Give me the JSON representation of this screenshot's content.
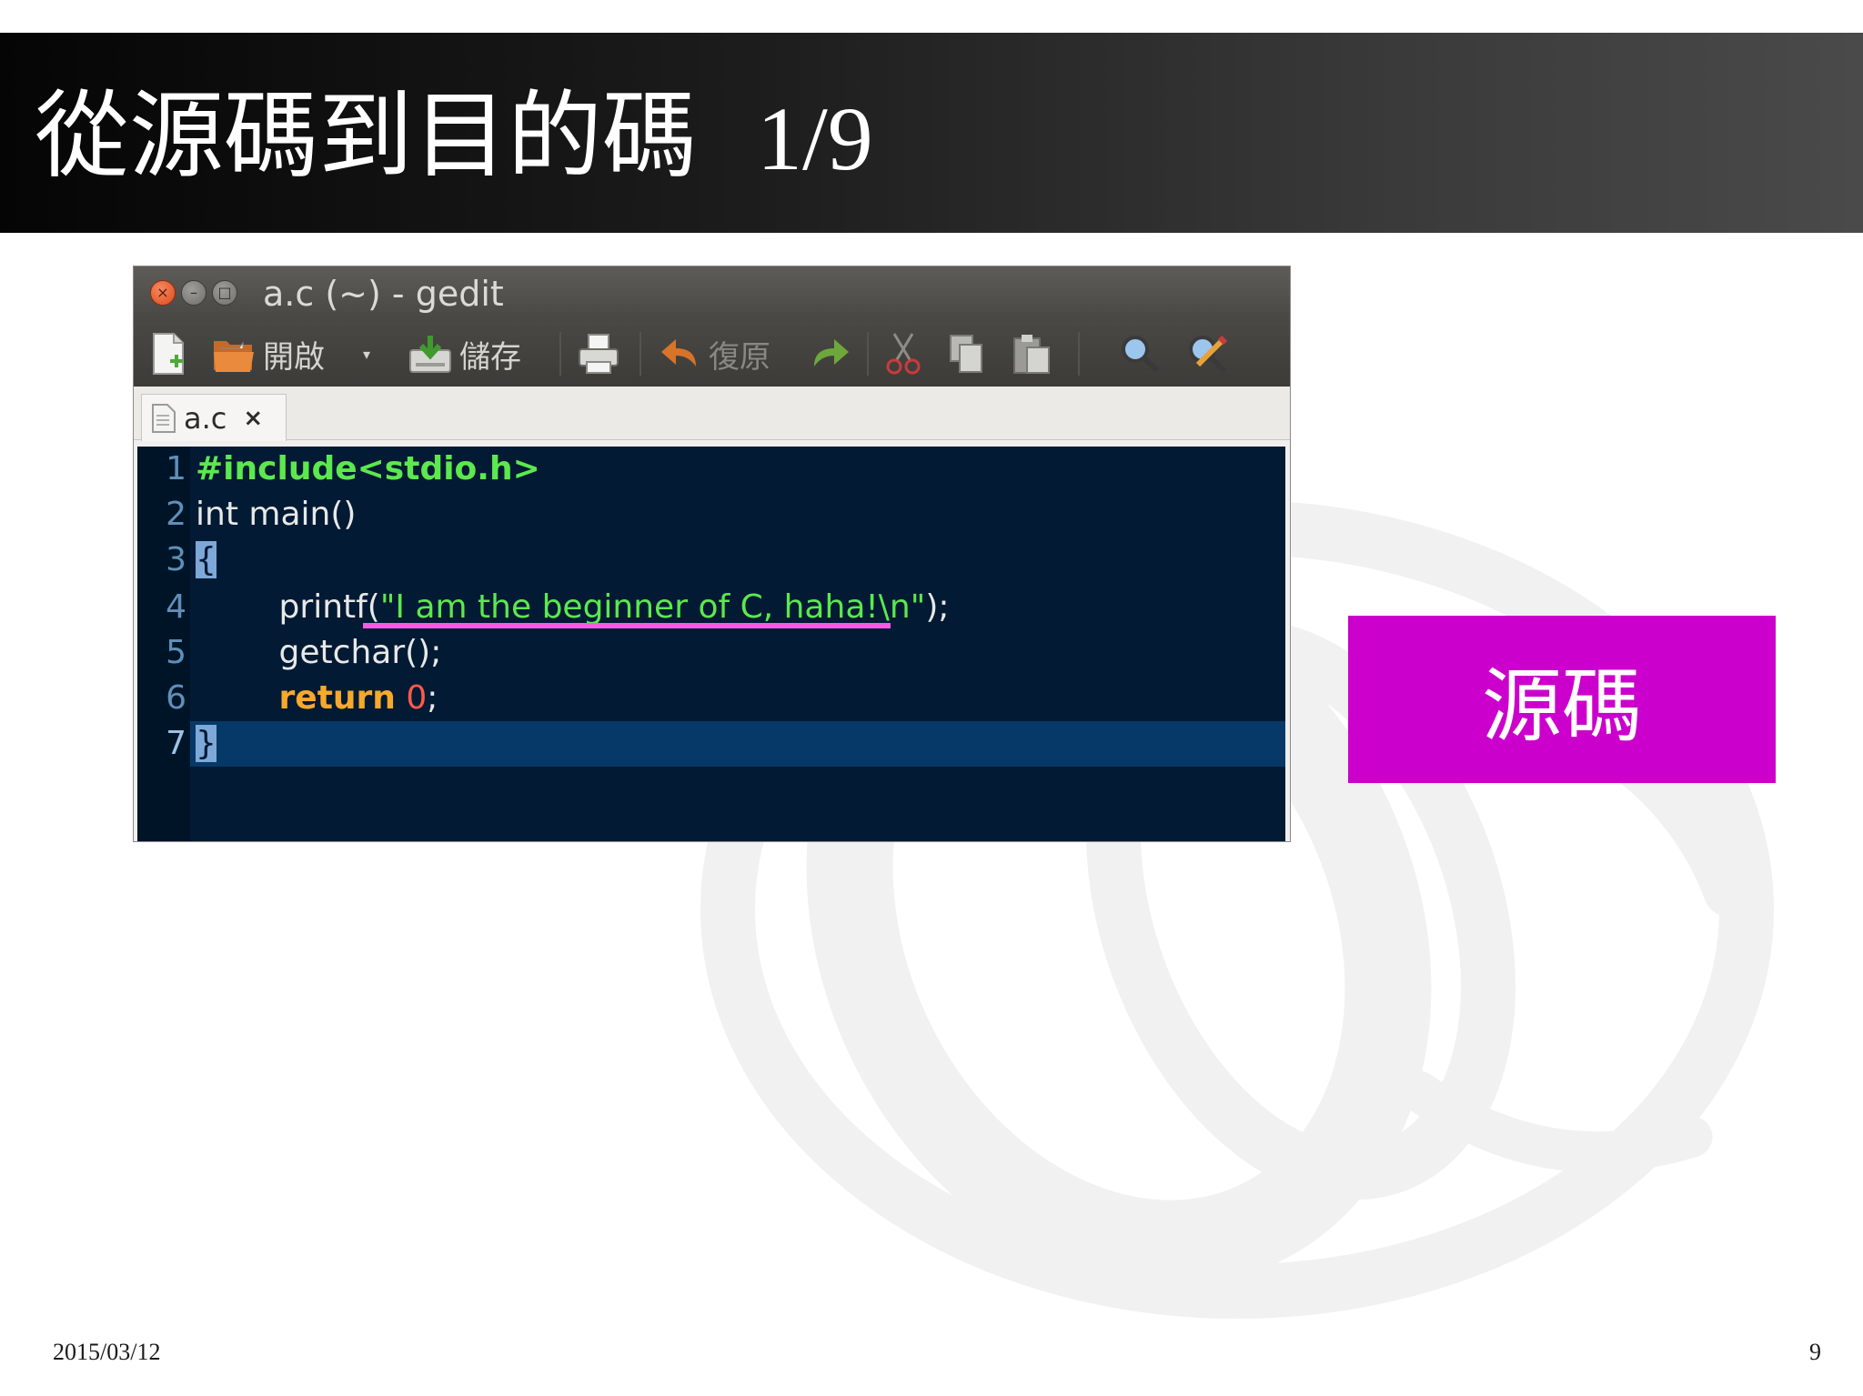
{
  "slide": {
    "title": "從源碼到目的碼",
    "page_indicator": "1/9",
    "label_box": "源碼",
    "footer_date": "2015/03/12",
    "footer_page": "9"
  },
  "window": {
    "title": "a.c (~) - gedit",
    "buttons": {
      "close": "×",
      "minimize": "–",
      "maximize": "□"
    }
  },
  "toolbar": {
    "new_icon": "new-document-icon",
    "open_label": "開啟",
    "open_dropdown": "▾",
    "save_label": "儲存",
    "print_icon": "print-icon",
    "undo_label": "復原",
    "redo_icon": "redo-icon",
    "cut_icon": "scissors-icon",
    "copy_icon": "copy-icon",
    "paste_icon": "paste-icon",
    "find_icon": "search-icon",
    "replace_icon": "find-replace-icon"
  },
  "tab": {
    "label": "a.c",
    "close": "×"
  },
  "editor": {
    "lines": [
      {
        "n": "1",
        "parts": [
          {
            "t": "#include",
            "c": "pre"
          },
          {
            "t": "<stdio.h>",
            "c": "pre"
          }
        ]
      },
      {
        "n": "2",
        "parts": [
          {
            "t": "int main()",
            "c": ""
          }
        ]
      },
      {
        "n": "3",
        "parts": [
          {
            "t": "{",
            "c": "brace"
          }
        ]
      },
      {
        "n": "4",
        "parts": [
          {
            "t": "        printf(",
            "c": ""
          },
          {
            "t": "\"I am the beginner of C, haha!\\n\"",
            "c": "str"
          },
          {
            "t": ");",
            "c": ""
          }
        ]
      },
      {
        "n": "5",
        "parts": [
          {
            "t": "        getchar();",
            "c": ""
          }
        ]
      },
      {
        "n": "6",
        "parts": [
          {
            "t": "        ",
            "c": ""
          },
          {
            "t": "return",
            "c": "kw"
          },
          {
            "t": " ",
            "c": ""
          },
          {
            "t": "0",
            "c": "num"
          },
          {
            "t": ";",
            "c": ""
          }
        ]
      },
      {
        "n": "7",
        "parts": [
          {
            "t": "}",
            "c": "brace"
          }
        ]
      }
    ],
    "current_line": "7"
  },
  "colors": {
    "title_bar": "#1c1c1c",
    "label_box": "#cc00cc",
    "editor_bg": "#021a33",
    "highlight_underline": "#f45ce4"
  }
}
